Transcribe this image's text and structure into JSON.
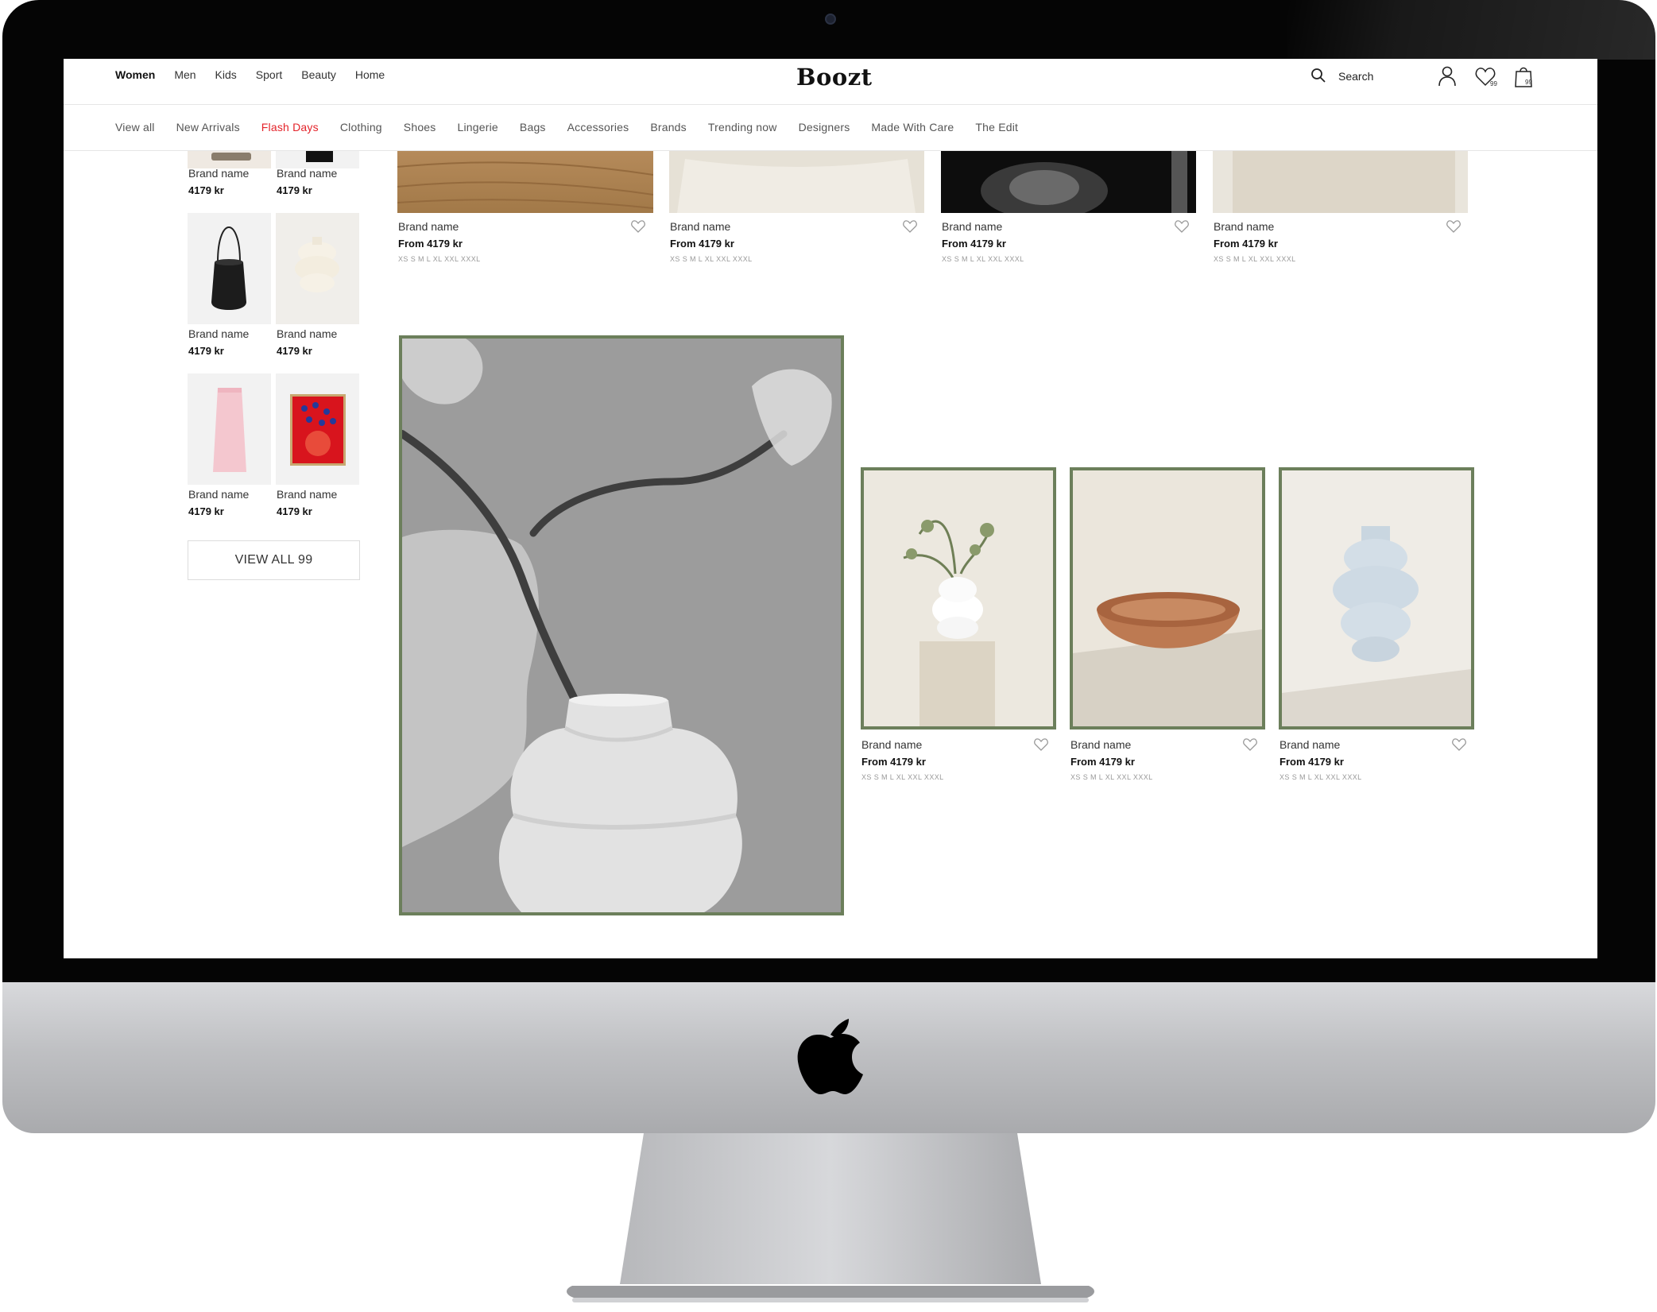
{
  "header": {
    "top_nav": [
      "Women",
      "Men",
      "Kids",
      "Sport",
      "Beauty",
      "Home"
    ],
    "logo": "Boozt",
    "search_label": "Search",
    "wishlist_count": "99",
    "bag_count": "99"
  },
  "sub_nav": [
    "View all",
    "New Arrivals",
    "Flash Days",
    "Clothing",
    "Shoes",
    "Lingerie",
    "Bags",
    "Accessories",
    "Brands",
    "Trending now",
    "Designers",
    "Made With Care",
    "The Edit"
  ],
  "sidebar": {
    "items": [
      {
        "name": "Brand name",
        "price": "4179 kr"
      },
      {
        "name": "Brand name",
        "price": "4179 kr"
      },
      {
        "name": "Brand name",
        "price": "4179 kr"
      },
      {
        "name": "Brand name",
        "price": "4179 kr"
      },
      {
        "name": "Brand name",
        "price": "4179 kr"
      },
      {
        "name": "Brand name",
        "price": "4179 kr"
      }
    ],
    "view_all": "VIEW ALL 99"
  },
  "top_products": [
    {
      "name": "Brand name",
      "price": "From 4179 kr",
      "sizes": "XS S M L XL XXL XXXL"
    },
    {
      "name": "Brand name",
      "price": "From 4179 kr",
      "sizes": "XS S M L XL XXL XXXL"
    },
    {
      "name": "Brand name",
      "price": "From 4179 kr",
      "sizes": "XS S M L XL XXL XXXL"
    },
    {
      "name": "Brand name",
      "price": "From 4179 kr",
      "sizes": "XS S M L XL XXL XXXL"
    }
  ],
  "feature_products": [
    {
      "name": "Brand name",
      "price": "From 4179 kr",
      "sizes": "XS S M L XL XXL XXXL"
    },
    {
      "name": "Brand name",
      "price": "From 4179 kr",
      "sizes": "XS S M L XL XXL XXXL"
    },
    {
      "name": "Brand name",
      "price": "From 4179 kr",
      "sizes": "XS S M L XL XXL XXXL"
    }
  ],
  "colors": {
    "accent_red": "#e4232a",
    "frame_green": "#6c7f5b",
    "bezel": "#050505",
    "aluminum": "#c4c5c8"
  }
}
